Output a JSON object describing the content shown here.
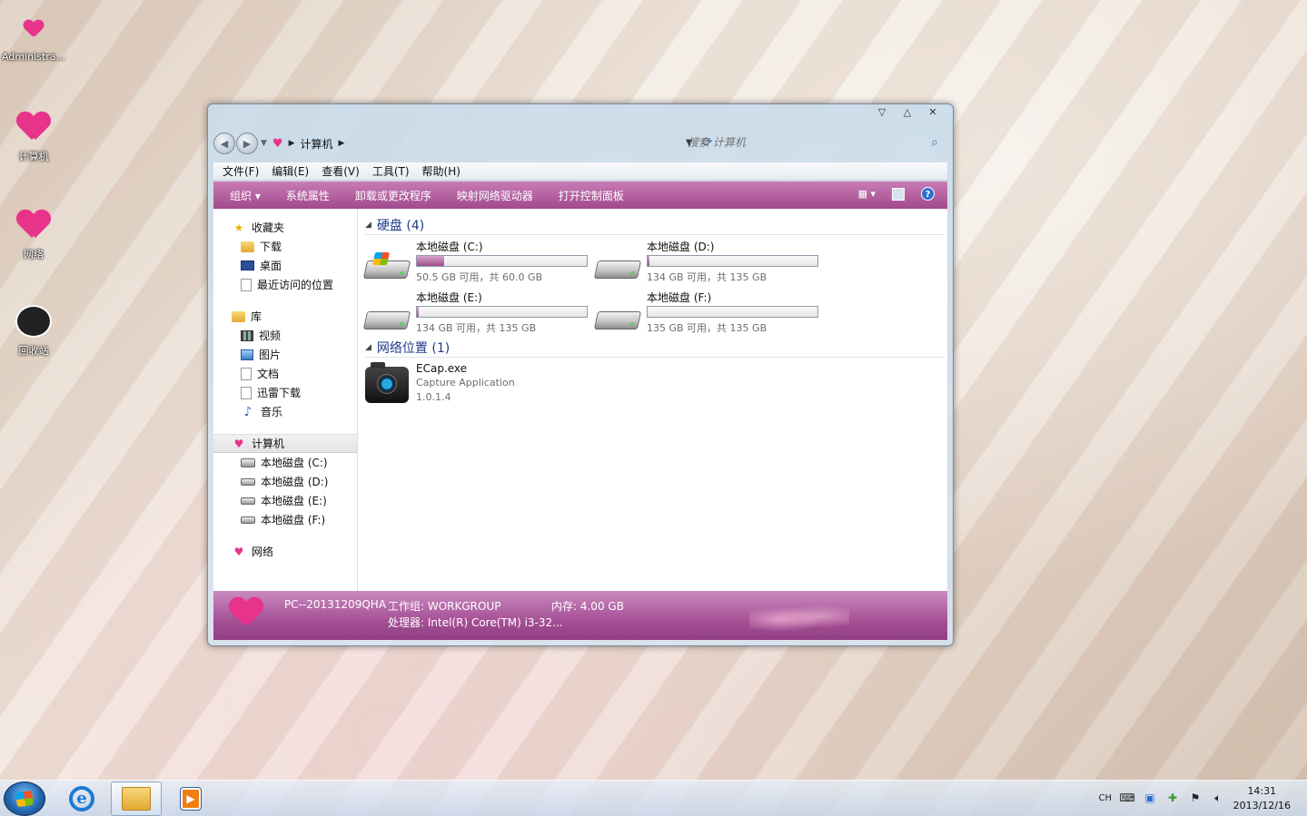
{
  "desktop": {
    "icons": [
      {
        "label": "Administra..."
      },
      {
        "label": "计算机"
      },
      {
        "label": "网络"
      },
      {
        "label": "回收站"
      }
    ]
  },
  "window": {
    "breadcrumb": [
      "计算机"
    ],
    "search_placeholder": "搜索 计算机",
    "menu": [
      "文件(F)",
      "编辑(E)",
      "查看(V)",
      "工具(T)",
      "帮助(H)"
    ],
    "toolbar": [
      "组织 ▾",
      "系统属性",
      "卸载或更改程序",
      "映射网络驱动器",
      "打开控制面板"
    ],
    "nav": {
      "favorites": {
        "label": "收藏夹",
        "items": [
          "下载",
          "桌面",
          "最近访问的位置"
        ]
      },
      "libraries": {
        "label": "库",
        "items": [
          "视频",
          "图片",
          "文档",
          "迅雷下载",
          "音乐"
        ]
      },
      "computer": {
        "label": "计算机",
        "items": [
          "本地磁盘 (C:)",
          "本地磁盘 (D:)",
          "本地磁盘 (E:)",
          "本地磁盘 (F:)"
        ]
      },
      "network": {
        "label": "网络"
      }
    },
    "sections": {
      "hdd_title": "硬盘 (4)",
      "drives": [
        {
          "name": "本地磁盘 (C:)",
          "free": "50.5 GB 可用，共 60.0 GB",
          "used_fraction": 0.16,
          "system": true
        },
        {
          "name": "本地磁盘 (D:)",
          "free": "134 GB 可用，共 135 GB",
          "used_fraction": 0.01,
          "system": false
        },
        {
          "name": "本地磁盘 (E:)",
          "free": "134 GB 可用，共 135 GB",
          "used_fraction": 0.01,
          "system": false
        },
        {
          "name": "本地磁盘 (F:)",
          "free": "135 GB 可用，共 135 GB",
          "used_fraction": 0.0,
          "system": false
        }
      ],
      "network_title": "网络位置 (1)",
      "network_item": {
        "name": "ECap.exe",
        "desc": "Capture Application",
        "version": "1.0.1.4"
      }
    },
    "details": {
      "pc_name": "PC--20131209QHA",
      "workgroup": "工作组: WORKGROUP",
      "memory": "内存: 4.00 GB",
      "processor": "处理器: Intel(R) Core(TM) i3-32..."
    }
  },
  "taskbar": {
    "lang": "CH",
    "time": "14:31",
    "date": "2013/12/16"
  },
  "colors": {
    "toolbar": "#a04a8c",
    "accent_pink": "#e8338b",
    "section_title": "#1e3b8a"
  }
}
